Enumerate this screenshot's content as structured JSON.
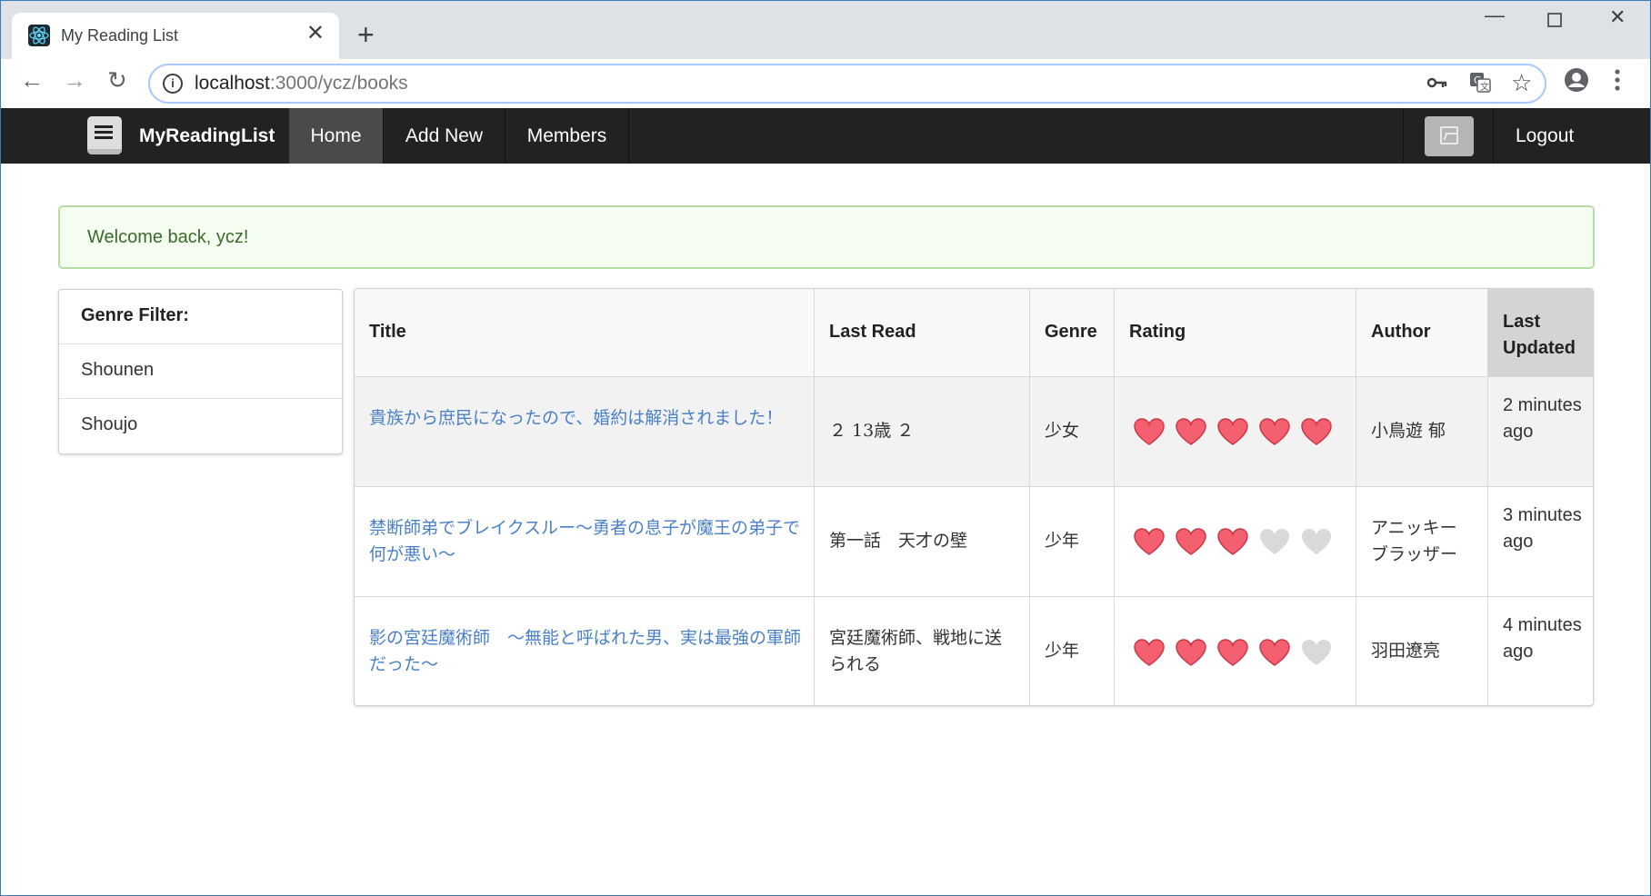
{
  "browser": {
    "tab_title": "My Reading List",
    "url_host": "localhost",
    "url_path": ":3000/ycz/books",
    "icons": {
      "back": "arrow-left-icon",
      "forward": "arrow-right-icon",
      "reload": "reload-icon",
      "info": "info-icon",
      "key": "key-icon",
      "translate": "translate-icon",
      "star": "star-icon",
      "profile": "profile-icon",
      "menu": "kebab-menu-icon"
    }
  },
  "navbar": {
    "brand": "MyReadingList",
    "items": [
      {
        "label": "Home",
        "active": true
      },
      {
        "label": "Add New",
        "active": false
      },
      {
        "label": "Members",
        "active": false
      }
    ],
    "logout": "Logout"
  },
  "alert": {
    "message": "Welcome back, ycz!"
  },
  "genre_filter": {
    "title": "Genre Filter:",
    "options": [
      "Shounen",
      "Shoujo"
    ]
  },
  "table": {
    "columns": [
      "Title",
      "Last Read",
      "Genre",
      "Rating",
      "Author",
      "Last Updated"
    ],
    "sorted_column": "Last Updated",
    "rows": [
      {
        "title": "貴族から庶民になったので、婚約は解消されました！",
        "last_read": "２ 13歳 ２",
        "genre": "少女",
        "rating": 5,
        "author": "小鳥遊 郁",
        "last_updated": "2 minutes ago"
      },
      {
        "title": "禁断師弟でブレイクスルー～勇者の息子が魔王の弟子で何が悪い～",
        "last_read": "第一話　天才の壁",
        "genre": "少年",
        "rating": 3,
        "author": "アニッキー ブラッザー",
        "last_updated": "3 minutes ago"
      },
      {
        "title": "影の宮廷魔術師　～無能と呼ばれた男、実は最強の軍師だった～",
        "last_read": "宮廷魔術師、戦地に送られる",
        "genre": "少年",
        "rating": 4,
        "author": "羽田遼亮",
        "last_updated": "4 minutes ago"
      }
    ],
    "rating_max": 5,
    "colors": {
      "heart_on": "#f56070",
      "heart_off": "#d9d9d9",
      "link": "#4a80c8"
    }
  }
}
